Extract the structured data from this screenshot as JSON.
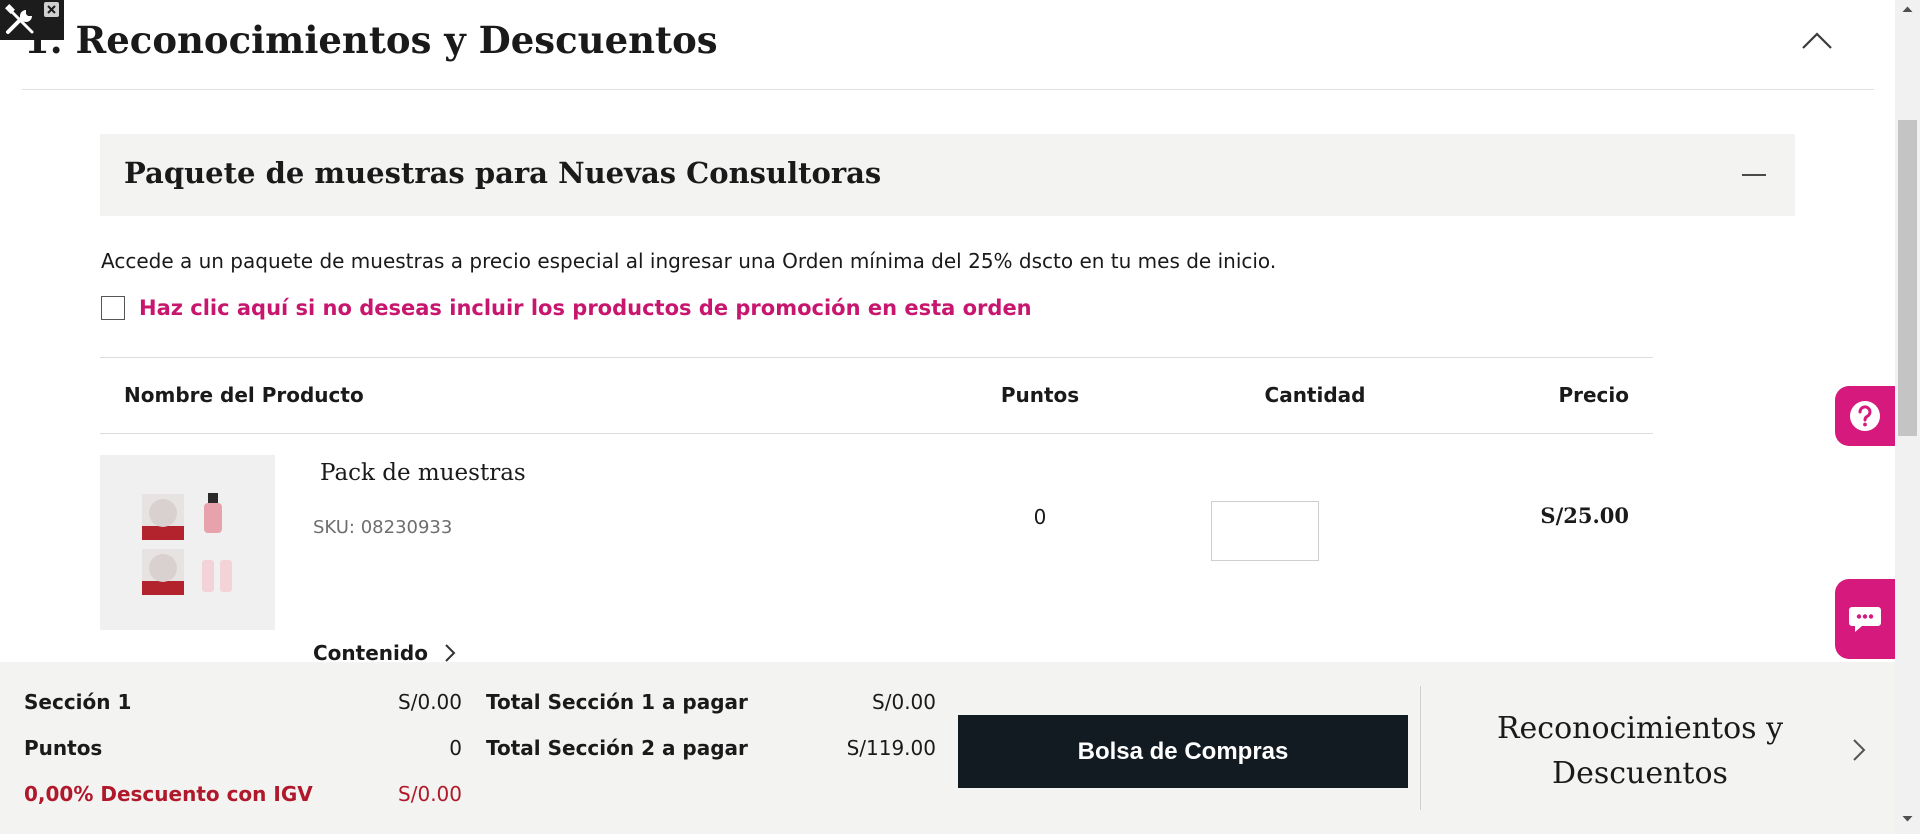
{
  "header": {
    "title": "1. Reconocimientos y Descuentos"
  },
  "promo": {
    "title": "Paquete de muestras para Nuevas Consultoras",
    "description": "Accede a un paquete de muestras a precio especial al ingresar una Orden mínima del 25% dscto en tu mes de inicio.",
    "opt_out_label": "Haz clic aquí si no deseas incluir los productos de promoción en esta orden",
    "opt_out_checked": false
  },
  "table": {
    "columns": [
      "Nombre del Producto",
      "Puntos",
      "Cantidad",
      "Precio"
    ]
  },
  "product": {
    "name": "Pack de muestras",
    "sku": "SKU: 08230933",
    "points": "0",
    "quantity": "",
    "price": "S/25.00",
    "contents_link": "Contenido"
  },
  "footer": {
    "section1_label": "Sección 1",
    "section1_value": "S/0.00",
    "points_label": "Puntos",
    "points_value": "0",
    "discount_label": "0,00% Descuento con IGV",
    "discount_value": "S/0.00",
    "total1_label": "Total Sección 1 a pagar",
    "total1_value": "S/0.00",
    "total2_label": "Total Sección 2 a pagar",
    "total2_value": "S/119.00",
    "bag_button": "Bolsa de Compras",
    "next_step_line1": "Reconocimientos y",
    "next_step_line2": "Descuentos"
  },
  "colors": {
    "accent": "#c8166f",
    "fab": "#d6197c",
    "discount": "#b0192b",
    "button_dark": "#121a22",
    "panel_bg": "#f3f3f1"
  },
  "icons": {
    "dev_tool": "wrench-screwdriver-icon",
    "close": "close-icon",
    "collapse": "chevron-up-icon",
    "minus": "minus-icon",
    "contents": "chevron-right-icon",
    "help": "question-mark-icon",
    "chat": "chat-bubble-icon",
    "next": "chevron-right-icon"
  }
}
